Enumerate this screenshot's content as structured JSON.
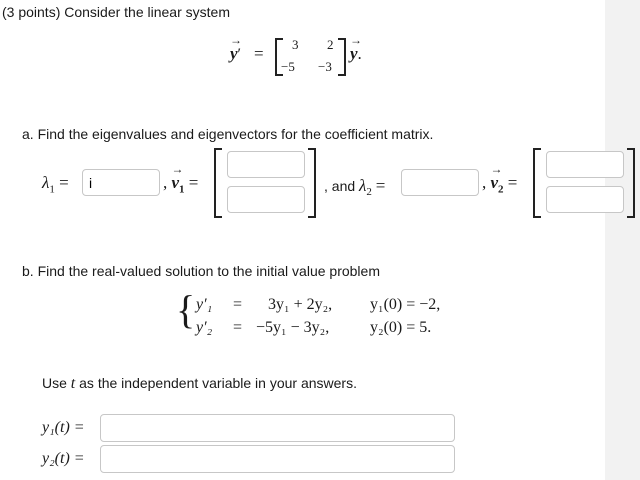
{
  "intro": "(3 points) Consider the linear system",
  "system": {
    "lhs": "y",
    "prime": "′",
    "equals": "=",
    "matrix": [
      [
        "3",
        "2"
      ],
      [
        "−5",
        "−3"
      ]
    ],
    "rhs": "y",
    "period": "."
  },
  "part_a": {
    "text": "a. Find the eigenvalues and eigenvectors for the coefficient matrix.",
    "lambda1": "λ",
    "sub1": "1",
    "eq": "=",
    "lambda1_value": "i",
    "comma": ",",
    "v": "v",
    "and_text": ", and",
    "lambda2": "λ",
    "sub2": "2"
  },
  "part_b": {
    "text": "b. Find the real-valued solution to the initial value problem",
    "equations": [
      {
        "lhs": "y′₁",
        "eq": "=",
        "rhs": "3y₁ + 2y₂,",
        "ic": "y₁(0) = −2,"
      },
      {
        "lhs": "y′₂",
        "eq": "=",
        "rhs": "−5y₁ − 3y₂,",
        "ic": "y₂(0) = 5."
      }
    ],
    "note_pre": "Use ",
    "note_t": "t",
    "note_post": " as the independent variable in your answers.",
    "y1_label": "y₁(t) =",
    "y2_label": "y₂(t) ="
  }
}
